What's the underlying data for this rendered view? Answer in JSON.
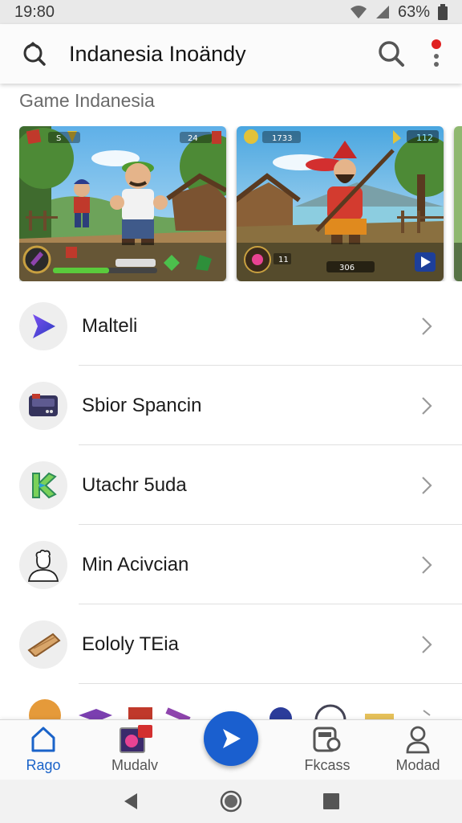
{
  "status_bar": {
    "time": "19:80",
    "battery": "63%"
  },
  "app_bar": {
    "title": "Indanesia Inoändy"
  },
  "section": {
    "title": "Game Indanesia"
  },
  "carousel": {
    "cards": [
      {
        "hud_left": "S",
        "hud_right": "24"
      },
      {
        "hud_left": "1733",
        "hud_right": "112",
        "level": "11",
        "score": "306"
      }
    ]
  },
  "list": {
    "items": [
      {
        "label": "Malteli",
        "icon": "play-triangle-icon"
      },
      {
        "label": "Sbior Spancin",
        "icon": "cartridge-icon"
      },
      {
        "label": "Utachr 5uda",
        "icon": "k-logo-icon"
      },
      {
        "label": "Min Acivcian",
        "icon": "user-outline-icon"
      },
      {
        "label": "Eololy TEia",
        "icon": "wood-plank-icon"
      }
    ]
  },
  "bottom_nav": {
    "items": [
      {
        "label": "Rago",
        "icon": "home-icon",
        "active": true
      },
      {
        "label": "Mudalv",
        "icon": "gallery-icon",
        "active": false
      },
      {
        "label": "Fkcass",
        "icon": "controller-icon",
        "active": false
      },
      {
        "label": "Modad",
        "icon": "person-icon",
        "active": false
      }
    ],
    "fab_icon": "play-icon"
  },
  "colors": {
    "accent": "#1a5fcf",
    "active_label": "#1a63c9",
    "notification_dot": "#e02020"
  }
}
